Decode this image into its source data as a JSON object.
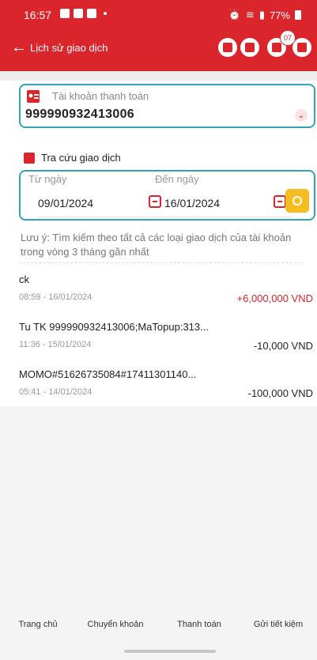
{
  "status_bar": {
    "time": "16:57",
    "battery": "77%"
  },
  "header": {
    "title": "Lịch sử giao dịch",
    "notif_count": "07"
  },
  "account": {
    "label": "Tài khoản thanh toán",
    "number": "999990932413006"
  },
  "search": {
    "section_title": "Tra cứu giao dịch",
    "from_label": "Từ ngày",
    "to_label": "Đến ngày",
    "from_date": "09/01/2024",
    "to_date": "16/01/2024"
  },
  "note": "Lưu ý: Tìm kiếm theo tất cả các loại giao dịch của tài khoản trong vòng 3 tháng gần nhất",
  "transactions": [
    {
      "desc": "ck",
      "time": "08:59 - 16/01/2024",
      "amount": "+6,000,000 VND"
    },
    {
      "desc": "Tu TK 999990932413006;MaTopup:313...",
      "time": "11:36 - 15/01/2024",
      "amount": "-10,000 VND"
    },
    {
      "desc": "MOMO#51626735084#17411301140...",
      "time": "05:41 - 14/01/2024",
      "amount": "-100,000 VND"
    }
  ],
  "bottom_nav": [
    {
      "label": "Trang chủ",
      "icon": "home-icon"
    },
    {
      "label": "Chuyển khoản",
      "icon": "transfer-icon"
    },
    {
      "label": "Thanh toán",
      "icon": "bill-icon"
    },
    {
      "label": "Gửi tiết kiệm",
      "icon": "piggy-bank-icon"
    }
  ],
  "colors": {
    "brand": "#d9252b",
    "accent_border": "#33a3b8",
    "search_button": "#f5bd20"
  }
}
